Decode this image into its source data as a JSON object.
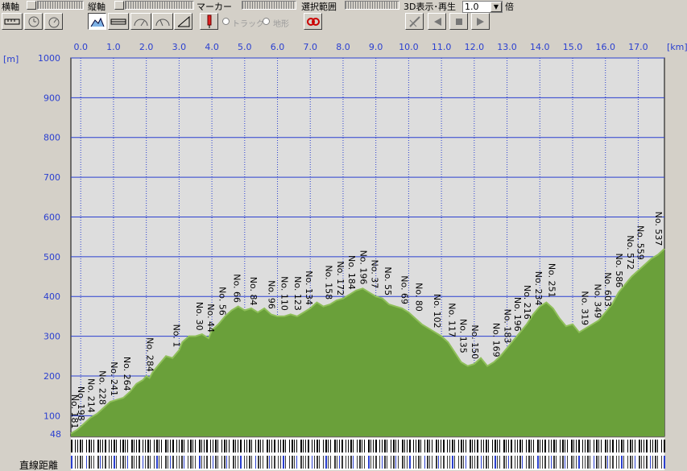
{
  "toolbar": {
    "xaxis_label": "横軸",
    "yaxis_label": "縦軸",
    "marker_label": "マーカー",
    "range_label": "選択範囲",
    "play3d_label": "3D表示･再生",
    "speed_value": "1.0",
    "speed_unit": "倍",
    "track_label": "トラック",
    "terrain_label": "地形",
    "icons": [
      "ruler-icon",
      "clock-icon",
      "speedometer-icon",
      "profile-mountain-icon",
      "flat-line-icon",
      "gauge-icon",
      "gauge-alt-icon",
      "slope-icon",
      "marker-pin-icon",
      "range-select-icon",
      "3d-view-icon",
      "play-back-icon",
      "stop-icon",
      "play-forward-icon"
    ]
  },
  "chart_data": {
    "type": "area",
    "x_unit": "[km]",
    "y_unit": "[m]",
    "xlim": [
      -0.3,
      17.8
    ],
    "ylim": [
      48,
      1000
    ],
    "x_ticks": [
      "0.0",
      "1.0",
      "2.0",
      "3.0",
      "4.0",
      "5.0",
      "6.0",
      "7.0",
      "8.0",
      "9.0",
      "10.0",
      "11.0",
      "12.0",
      "13.0",
      "14.0",
      "15.0",
      "16.0",
      "17.0"
    ],
    "y_ticks": [
      "1000",
      "900",
      "800",
      "700",
      "600",
      "500",
      "400",
      "300",
      "200",
      "100"
    ],
    "y_min_label": "48",
    "grid": true,
    "fill_color": "#6aa03a",
    "top_fill_color": "#8fbf5a",
    "background_color": "#dddddd",
    "grid_color": "#2a3fd0",
    "profile_x": [
      -0.3,
      -0.1,
      0.1,
      0.3,
      0.5,
      0.7,
      0.9,
      1.1,
      1.3,
      1.5,
      1.7,
      1.9,
      2.0,
      2.1,
      2.2,
      2.4,
      2.6,
      2.8,
      3.0,
      3.1,
      3.3,
      3.5,
      3.7,
      3.9,
      4.0,
      4.2,
      4.4,
      4.6,
      4.8,
      5.0,
      5.2,
      5.4,
      5.6,
      5.8,
      6.0,
      6.2,
      6.4,
      6.6,
      6.8,
      7.0,
      7.2,
      7.4,
      7.6,
      7.8,
      8.0,
      8.2,
      8.4,
      8.6,
      8.8,
      9.0,
      9.2,
      9.4,
      9.6,
      9.8,
      10.0,
      10.2,
      10.4,
      10.6,
      10.8,
      11.0,
      11.2,
      11.4,
      11.6,
      11.8,
      12.0,
      12.2,
      12.4,
      12.6,
      12.8,
      13.0,
      13.2,
      13.4,
      13.6,
      13.8,
      14.0,
      14.2,
      14.4,
      14.6,
      14.8,
      15.0,
      15.2,
      15.4,
      15.6,
      15.8,
      16.0,
      16.2,
      16.4,
      16.6,
      16.8,
      17.0,
      17.2,
      17.4,
      17.6,
      17.8
    ],
    "profile_y": [
      55,
      65,
      80,
      95,
      105,
      120,
      135,
      140,
      145,
      160,
      180,
      190,
      200,
      195,
      210,
      230,
      250,
      245,
      265,
      285,
      300,
      300,
      305,
      295,
      315,
      330,
      350,
      365,
      375,
      365,
      370,
      360,
      370,
      355,
      350,
      350,
      355,
      350,
      360,
      370,
      385,
      375,
      380,
      390,
      395,
      405,
      415,
      420,
      410,
      400,
      395,
      380,
      375,
      370,
      360,
      345,
      330,
      320,
      310,
      300,
      285,
      260,
      235,
      225,
      230,
      245,
      225,
      235,
      250,
      270,
      290,
      310,
      330,
      355,
      375,
      385,
      370,
      345,
      325,
      330,
      310,
      320,
      330,
      340,
      360,
      380,
      410,
      430,
      450,
      465,
      480,
      495,
      505,
      520
    ],
    "stations": [
      {
        "label": "No. 181",
        "x": -0.3,
        "y": 55
      },
      {
        "label": "No. 198",
        "x": 0.0,
        "y": 75
      },
      {
        "label": "No. 214",
        "x": 0.3,
        "y": 95
      },
      {
        "label": "No. 228",
        "x": 0.65,
        "y": 115
      },
      {
        "label": "No. 241",
        "x": 1.0,
        "y": 137
      },
      {
        "label": "No. 264",
        "x": 1.4,
        "y": 150
      },
      {
        "label": "No. 284",
        "x": 2.1,
        "y": 198
      },
      {
        "label": "No. 1",
        "x": 2.9,
        "y": 260
      },
      {
        "label": "No. 30",
        "x": 3.6,
        "y": 302
      },
      {
        "label": "No. 44",
        "x": 3.95,
        "y": 297
      },
      {
        "label": "No. 56",
        "x": 4.3,
        "y": 340
      },
      {
        "label": "No. 66",
        "x": 4.75,
        "y": 372
      },
      {
        "label": "No. 84",
        "x": 5.25,
        "y": 365
      },
      {
        "label": "No. 96",
        "x": 5.8,
        "y": 356
      },
      {
        "label": "No. 110",
        "x": 6.2,
        "y": 352
      },
      {
        "label": "No. 123",
        "x": 6.6,
        "y": 352
      },
      {
        "label": "No. 134",
        "x": 6.95,
        "y": 366
      },
      {
        "label": "No. 158",
        "x": 7.55,
        "y": 380
      },
      {
        "label": "No. 172",
        "x": 7.9,
        "y": 390
      },
      {
        "label": "No. 184",
        "x": 8.25,
        "y": 405
      },
      {
        "label": "No. 196",
        "x": 8.6,
        "y": 418
      },
      {
        "label": "No. 37",
        "x": 8.95,
        "y": 408
      },
      {
        "label": "No. 55",
        "x": 9.35,
        "y": 390
      },
      {
        "label": "No. 69",
        "x": 9.85,
        "y": 368
      },
      {
        "label": "No. 80",
        "x": 10.3,
        "y": 350
      },
      {
        "label": "No. 102",
        "x": 10.85,
        "y": 308
      },
      {
        "label": "No. 117",
        "x": 11.3,
        "y": 285
      },
      {
        "label": "No. 135",
        "x": 11.65,
        "y": 245
      },
      {
        "label": "No. 150",
        "x": 12.0,
        "y": 230
      },
      {
        "label": "No. 169",
        "x": 12.65,
        "y": 235
      },
      {
        "label": "No. 183",
        "x": 13.0,
        "y": 270
      },
      {
        "label": "No. 196",
        "x": 13.3,
        "y": 300
      },
      {
        "label": "No. 216",
        "x": 13.6,
        "y": 330
      },
      {
        "label": "No. 234",
        "x": 13.95,
        "y": 365
      },
      {
        "label": "No. 251",
        "x": 14.35,
        "y": 385
      },
      {
        "label": "No. 319",
        "x": 15.35,
        "y": 315
      },
      {
        "label": "No. 349",
        "x": 15.75,
        "y": 333
      },
      {
        "label": "No. 603",
        "x": 16.05,
        "y": 362
      },
      {
        "label": "No. 586",
        "x": 16.4,
        "y": 410
      },
      {
        "label": "No. 572",
        "x": 16.75,
        "y": 455
      },
      {
        "label": "No. 559",
        "x": 17.05,
        "y": 480
      },
      {
        "label": "No. 537",
        "x": 17.6,
        "y": 515
      }
    ]
  },
  "bottom": {
    "row_label": "直線距離"
  }
}
